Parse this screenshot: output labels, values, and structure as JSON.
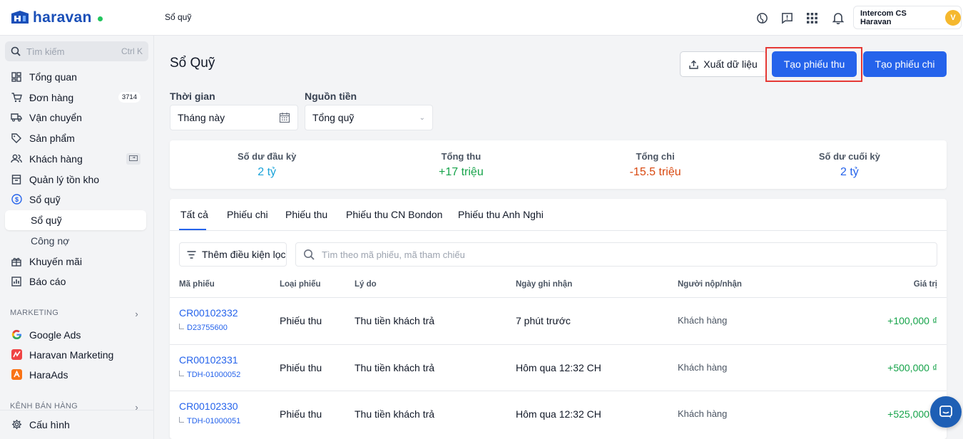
{
  "brand": {
    "name": "haravan"
  },
  "header": {
    "breadcrumb": "Sổ quỹ",
    "account_name": "Intercom CS Haravan",
    "avatar_letter": "V"
  },
  "sidebar": {
    "search_placeholder": "Tìm kiếm",
    "search_shortcut": "Ctrl K",
    "items": [
      {
        "label": "Tổng quan",
        "icon": "dashboard-icon"
      },
      {
        "label": "Đơn hàng",
        "icon": "cart-icon",
        "badge": "3714"
      },
      {
        "label": "Vận chuyển",
        "icon": "truck-icon"
      },
      {
        "label": "Sản phẩm",
        "icon": "tag-icon"
      },
      {
        "label": "Khách hàng",
        "icon": "users-icon"
      },
      {
        "label": "Quản lý tồn kho",
        "icon": "inventory-icon"
      },
      {
        "label": "Sổ quỹ",
        "icon": "dollar-circle-icon"
      }
    ],
    "sub_items": [
      {
        "label": "Sổ quỹ",
        "active": true
      },
      {
        "label": "Công nợ",
        "active": false
      }
    ],
    "items2": [
      {
        "label": "Khuyến mãi",
        "icon": "gift-icon"
      },
      {
        "label": "Báo cáo",
        "icon": "chart-icon"
      }
    ],
    "marketing_title": "MARKETING",
    "marketing_items": [
      {
        "label": "Google Ads",
        "icon": "google-icon"
      },
      {
        "label": "Haravan Marketing",
        "icon": "haravan-marketing-icon"
      },
      {
        "label": "HaraAds",
        "icon": "haraads-icon"
      }
    ],
    "sales_channel_title": "KÊNH BÁN HÀNG",
    "settings_label": "Cấu hình"
  },
  "page": {
    "title": "Sổ Quỹ",
    "export_label": "Xuất dữ liệu",
    "create_receipt_label": "Tạo phiếu thu",
    "create_payment_label": "Tạo phiếu chi"
  },
  "filters": {
    "time_label": "Thời gian",
    "time_value": "Tháng này",
    "source_label": "Nguồn tiền",
    "source_value": "Tổng quỹ"
  },
  "summary": [
    {
      "label": "Số dư đầu kỳ",
      "value": "2 tỷ",
      "color": "#1aa3d9"
    },
    {
      "label": "Tổng thu",
      "value": "+17 triệu",
      "color": "#16a34a"
    },
    {
      "label": "Tổng chi",
      "value": "-15.5 triệu",
      "color": "#d9480f"
    },
    {
      "label": "Số dư cuối kỳ",
      "value": "2 tỷ",
      "color": "#2563eb"
    }
  ],
  "tabs": [
    "Tất cả",
    "Phiếu chi",
    "Phiếu thu",
    "Phiếu thu CN Bondon",
    "Phiếu thu Anh Nghi"
  ],
  "table": {
    "filter_label": "Thêm điều kiện lọc",
    "search_placeholder": "Tìm theo mã phiếu, mã tham chiếu",
    "columns": [
      "Mã phiếu",
      "Loại phiếu",
      "Lý do",
      "Ngày ghi nhận",
      "Người nộp/nhận",
      "Giá trị"
    ],
    "rows": [
      {
        "code": "CR00102332",
        "ref": "D23755600",
        "type": "Phiếu thu",
        "reason": "Thu tiền khách trả",
        "date": "7 phút trước",
        "party": "Khách hàng",
        "amount": "+100,000 ₫"
      },
      {
        "code": "CR00102331",
        "ref": "TDH-01000052",
        "type": "Phiếu thu",
        "reason": "Thu tiền khách trả",
        "date": "Hôm qua 12:32 CH",
        "party": "Khách hàng",
        "amount": "+500,000 ₫"
      },
      {
        "code": "CR00102330",
        "ref": "TDH-01000051",
        "type": "Phiếu thu",
        "reason": "Thu tiền khách trả",
        "date": "Hôm qua 12:32 CH",
        "party": "Khách hàng",
        "amount": "+525,000 ₫"
      }
    ]
  }
}
